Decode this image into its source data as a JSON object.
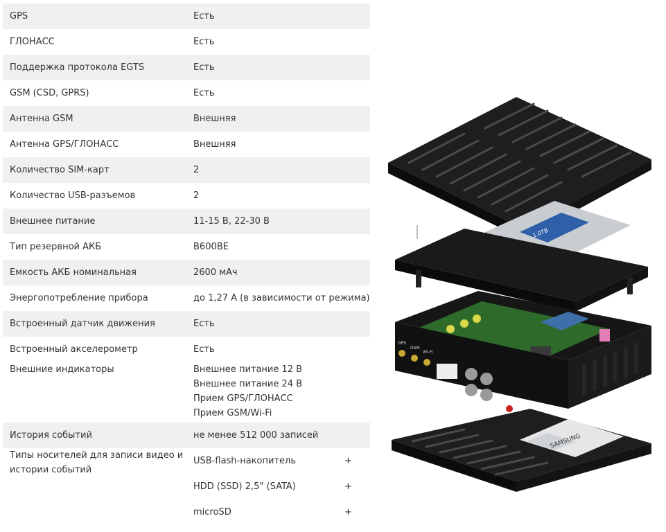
{
  "specs": [
    {
      "label": "GPS",
      "value": "Есть"
    },
    {
      "label": "ГЛОНАСС",
      "value": "Есть"
    },
    {
      "label": "Поддержка протокола EGTS",
      "value": "Есть"
    },
    {
      "label": "GSM (CSD, GPRS)",
      "value": "Есть"
    },
    {
      "label": "Антенна GSM",
      "value": "Внешняя"
    },
    {
      "label": "Антенна GPS/ГЛОНАСС",
      "value": "Внешняя"
    },
    {
      "label": "Количество SIM-карт",
      "value": "2"
    },
    {
      "label": "Количество USB-разъемов",
      "value": "2"
    },
    {
      "label": "Внешнее питание",
      "value": "11-15 В, 22-30 В"
    },
    {
      "label": "Тип резервной АКБ",
      "value": "B600BE"
    },
    {
      "label": "Емкость АКБ номинальная",
      "value": "2600 мАч"
    },
    {
      "label": "Энергопотребление прибора",
      "value": "до 1,27 А (в зависимости от режима)"
    },
    {
      "label": "Встроенный датчик движения",
      "value": "Есть"
    },
    {
      "label": "Встроенный акселерометр",
      "value": "Есть"
    }
  ],
  "indicators": {
    "label": "Внешние индикаторы",
    "values": [
      "Внешнее питание 12 В",
      "Внешнее питание 24 В",
      "Прием GPS/ГЛОНАСС",
      "Прием GSM/Wi-Fi"
    ]
  },
  "history": {
    "label": "История событий",
    "value": "не менее 512 000 записей"
  },
  "media": {
    "label": "Типы носителей для записи видео и истории событий",
    "items": [
      {
        "name": "USB-flash-накопитель",
        "mark": "+"
      },
      {
        "name": "HDD (SSD) 2,5\" (SATA)",
        "mark": "+"
      },
      {
        "name": "microSD",
        "mark": "+"
      }
    ]
  },
  "device_image": {
    "hdd_label": "1.0TB",
    "battery_brand": "SAMSUNG",
    "port_labels": [
      "GPS",
      "GSM",
      "Wi-Fi"
    ]
  }
}
